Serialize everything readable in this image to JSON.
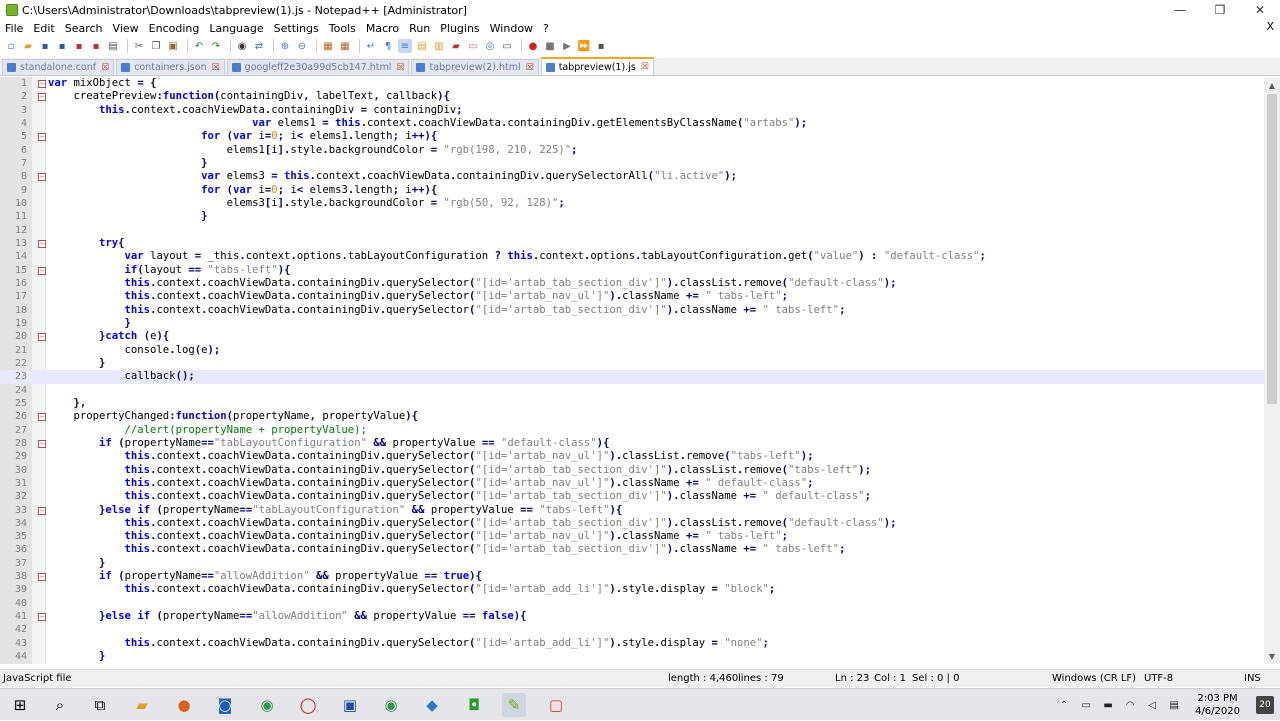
{
  "window": {
    "title": "C:\\Users\\Administrator\\Downloads\\tabpreview(1).js - Notepad++ [Administrator]",
    "minimize": "—",
    "maximize": "❐",
    "close": "✕"
  },
  "menu": [
    "File",
    "Edit",
    "Search",
    "View",
    "Encoding",
    "Language",
    "Settings",
    "Tools",
    "Macro",
    "Run",
    "Plugins",
    "Window",
    "?"
  ],
  "menu_close": "X",
  "tabs": [
    {
      "label": "standalone.conf",
      "active": false
    },
    {
      "label": "containers.json",
      "active": false
    },
    {
      "label": "googleff2e30a99d5cb147.html",
      "active": false
    },
    {
      "label": "tabpreview(2).html",
      "active": false
    },
    {
      "label": "tabpreview(1).js",
      "active": true
    }
  ],
  "editor": {
    "current_line": 23,
    "fold_lines": [
      1,
      2,
      5,
      8,
      13,
      15,
      20,
      26,
      28,
      33,
      38,
      41
    ],
    "lines": [
      {
        "n": 1,
        "t": "var mixObject = {"
      },
      {
        "n": 2,
        "t": "    createPreview:function(containingDiv, labelText, callback){"
      },
      {
        "n": 3,
        "t": "        this.context.coachViewData.containingDiv = containingDiv;"
      },
      {
        "n": 4,
        "t": "                                var elems1 = this.context.coachViewData.containingDiv.getElementsByClassName(\"artabs\");"
      },
      {
        "n": 5,
        "t": "                        for (var i=0; i< elems1.length; i++){"
      },
      {
        "n": 6,
        "t": "                            elems1[i].style.backgroundColor = \"rgb(198, 210, 225)\";"
      },
      {
        "n": 7,
        "t": "                        }"
      },
      {
        "n": 8,
        "t": "                        var elems3 = this.context.coachViewData.containingDiv.querySelectorAll(\"li.active\");"
      },
      {
        "n": 9,
        "t": "                        for (var i=0; i< elems3.length; i++){"
      },
      {
        "n": 10,
        "t": "                            elems3[i].style.backgroundColor = \"rgb(50, 92, 128)\";"
      },
      {
        "n": 11,
        "t": "                        }"
      },
      {
        "n": 12,
        "t": ""
      },
      {
        "n": 13,
        "t": "        try{"
      },
      {
        "n": 14,
        "t": "            var layout = _this.context.options.tabLayoutConfiguration ? this.context.options.tabLayoutConfiguration.get(\"value\") : \"default-class\";"
      },
      {
        "n": 15,
        "t": "            if(layout == \"tabs-left\"){"
      },
      {
        "n": 16,
        "t": "            this.context.coachViewData.containingDiv.querySelector(\"[id='artab_tab_section_div']\").classList.remove(\"default-class\");"
      },
      {
        "n": 17,
        "t": "            this.context.coachViewData.containingDiv.querySelector(\"[id='artab_nav_ul']\").className += \" tabs-left\";"
      },
      {
        "n": 18,
        "t": "            this.context.coachViewData.containingDiv.querySelector(\"[id='artab_tab_section_div']\").className += \" tabs-left\";"
      },
      {
        "n": 19,
        "t": "            }"
      },
      {
        "n": 20,
        "t": "        }catch (e){"
      },
      {
        "n": 21,
        "t": "            console.log(e);"
      },
      {
        "n": 22,
        "t": "        }"
      },
      {
        "n": 23,
        "t": "            callback();"
      },
      {
        "n": 24,
        "t": ""
      },
      {
        "n": 25,
        "t": "    },"
      },
      {
        "n": 26,
        "t": "    propertyChanged:function(propertyName, propertyValue){"
      },
      {
        "n": 27,
        "t": "            //alert(propertyName + propertyValue);"
      },
      {
        "n": 28,
        "t": "        if (propertyName==\"tabLayoutConfiguration\" && propertyValue == \"default-class\"){"
      },
      {
        "n": 29,
        "t": "            this.context.coachViewData.containingDiv.querySelector(\"[id='artab_nav_ul']\").classList.remove(\"tabs-left\");"
      },
      {
        "n": 30,
        "t": "            this.context.coachViewData.containingDiv.querySelector(\"[id='artab_tab_section_div']\").classList.remove(\"tabs-left\");"
      },
      {
        "n": 31,
        "t": "            this.context.coachViewData.containingDiv.querySelector(\"[id='artab_nav_ul']\").className += \" default-class\";"
      },
      {
        "n": 32,
        "t": "            this.context.coachViewData.containingDiv.querySelector(\"[id='artab_tab_section_div']\").className += \" default-class\";"
      },
      {
        "n": 33,
        "t": "        }else if (propertyName==\"tabLayoutConfiguration\" && propertyValue == \"tabs-left\"){"
      },
      {
        "n": 34,
        "t": "            this.context.coachViewData.containingDiv.querySelector(\"[id='artab_tab_section_div']\").classList.remove(\"default-class\");"
      },
      {
        "n": 35,
        "t": "            this.context.coachViewData.containingDiv.querySelector(\"[id='artab_nav_ul']\").className += \" tabs-left\";"
      },
      {
        "n": 36,
        "t": "            this.context.coachViewData.containingDiv.querySelector(\"[id='artab_tab_section_div']\").className += \" tabs-left\";"
      },
      {
        "n": 37,
        "t": "        }"
      },
      {
        "n": 38,
        "t": "        if (propertyName==\"allowAddition\" && propertyValue == true){"
      },
      {
        "n": 39,
        "t": "            this.context.coachViewData.containingDiv.querySelector(\"[id='artab_add_li']\").style.display = \"block\";"
      },
      {
        "n": 40,
        "t": ""
      },
      {
        "n": 41,
        "t": "        }else if (propertyName==\"allowAddition\" && propertyValue == false){"
      },
      {
        "n": 42,
        "t": ""
      },
      {
        "n": 43,
        "t": "            this.context.coachViewData.containingDiv.querySelector(\"[id='artab_add_li']\").style.display = \"none\";"
      },
      {
        "n": 44,
        "t": "        }"
      }
    ]
  },
  "status": {
    "file_type": "JavaScript file",
    "length": "length : 4,460",
    "lines": "lines : 79",
    "ln": "Ln : 23",
    "col": "Col : 1",
    "sel": "Sel : 0 | 0",
    "eol": "Windows (CR LF)",
    "encoding": "UTF-8",
    "mode": "INS"
  },
  "taskbar": {
    "time": "2:03 PM",
    "date": "4/6/2020",
    "notifications": "20"
  },
  "colors": {
    "keyword": "#0000ff",
    "string": "#808080",
    "number": "#ff8000",
    "comment": "#008000",
    "current_line": "#e8e8ff"
  }
}
